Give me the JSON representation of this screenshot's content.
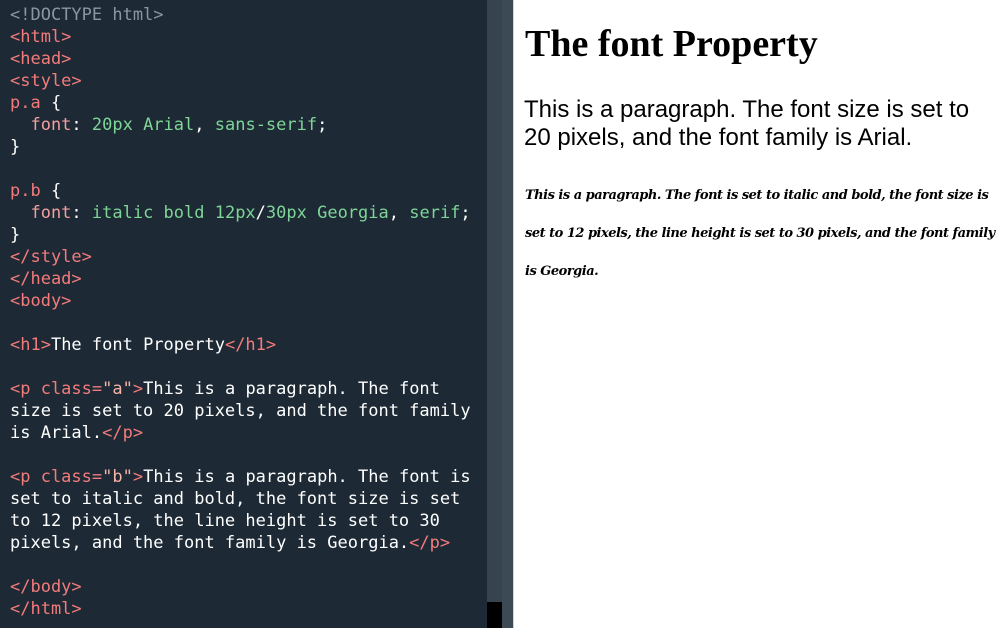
{
  "editor": {
    "lines": [
      [
        {
          "t": "<!DOCTYPE html>",
          "c": "muted"
        }
      ],
      [
        {
          "t": "<html>",
          "c": "tag"
        }
      ],
      [
        {
          "t": "<head>",
          "c": "tag"
        }
      ],
      [
        {
          "t": "<style>",
          "c": "tag"
        }
      ],
      [
        {
          "t": "p.a",
          "c": "tag"
        },
        {
          "t": " {",
          "c": "text"
        }
      ],
      [
        {
          "t": "  font",
          "c": "prop"
        },
        {
          "t": ": ",
          "c": "text"
        },
        {
          "t": "20px Arial",
          "c": "val"
        },
        {
          "t": ", ",
          "c": "text"
        },
        {
          "t": "sans-serif",
          "c": "val"
        },
        {
          "t": ";",
          "c": "text"
        }
      ],
      [
        {
          "t": "}",
          "c": "text"
        }
      ],
      [],
      [
        {
          "t": "p.b",
          "c": "tag"
        },
        {
          "t": " {",
          "c": "text"
        }
      ],
      [
        {
          "t": "  font",
          "c": "prop"
        },
        {
          "t": ": ",
          "c": "text"
        },
        {
          "t": "italic bold 12px",
          "c": "val"
        },
        {
          "t": "/",
          "c": "text"
        },
        {
          "t": "30px Georgia",
          "c": "val"
        },
        {
          "t": ", ",
          "c": "text"
        },
        {
          "t": "serif",
          "c": "val"
        },
        {
          "t": ";",
          "c": "text"
        }
      ],
      [
        {
          "t": "}",
          "c": "text"
        }
      ],
      [
        {
          "t": "</style>",
          "c": "tag"
        }
      ],
      [
        {
          "t": "</head>",
          "c": "tag"
        }
      ],
      [
        {
          "t": "<body>",
          "c": "tag"
        }
      ],
      [],
      [
        {
          "t": "<h1>",
          "c": "tag"
        },
        {
          "t": "The font Property",
          "c": "text"
        },
        {
          "t": "</h1>",
          "c": "tag"
        }
      ],
      [],
      [
        {
          "t": "<p class=",
          "c": "tag"
        },
        {
          "t": "\"a\"",
          "c": "attrv"
        },
        {
          "t": ">",
          "c": "tag"
        },
        {
          "t": "This is a paragraph. The font",
          "c": "text"
        }
      ],
      [
        {
          "t": "size is set to 20 pixels, and the font family",
          "c": "text"
        }
      ],
      [
        {
          "t": "is Arial.",
          "c": "text"
        },
        {
          "t": "</p>",
          "c": "tag"
        }
      ],
      [],
      [
        {
          "t": "<p class=",
          "c": "tag"
        },
        {
          "t": "\"b\"",
          "c": "attrv"
        },
        {
          "t": ">",
          "c": "tag"
        },
        {
          "t": "This is a paragraph. The font is",
          "c": "text"
        }
      ],
      [
        {
          "t": "set to italic and bold, the font size is set",
          "c": "text"
        }
      ],
      [
        {
          "t": "to 12 pixels, the line height is set to 30",
          "c": "text"
        }
      ],
      [
        {
          "t": "pixels, and the font family is Georgia.",
          "c": "text"
        },
        {
          "t": "</p>",
          "c": "tag"
        }
      ],
      [],
      [
        {
          "t": "</body>",
          "c": "tag"
        }
      ],
      [
        {
          "t": "</html>",
          "c": "tag"
        }
      ]
    ]
  },
  "preview": {
    "heading": "The font Property",
    "paragraph_a": "This is a paragraph. The font size is set to 20 pixels, and the font family is Arial.",
    "paragraph_b": "This is a paragraph. The font is set to italic and bold, the font size is set to 12 pixels, the line height is set to 30 pixels, and the font family is Georgia."
  },
  "colors": {
    "editor_bg": "#1d2a35",
    "tag": "#f47b7b",
    "value": "#7ed597",
    "muted": "#8a97a3"
  }
}
